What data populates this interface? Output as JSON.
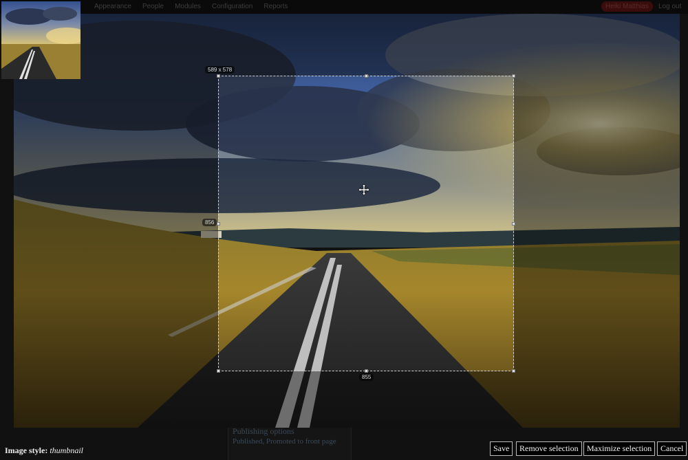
{
  "toolbar": {
    "nav": [
      "Appearance",
      "People",
      "Modules",
      "Configuration",
      "Reports"
    ],
    "user": "Heiki Matthias",
    "logout": "Log out"
  },
  "background_page": {
    "heading": "Publishing options",
    "text": "Published, Promoted to front page"
  },
  "cropper": {
    "size_label": "589 x 578",
    "height_value": "856",
    "width_value": "855"
  },
  "footer": {
    "style_prefix": "Image style:",
    "style_name": "thumbnail"
  },
  "actions": {
    "save": "Save",
    "remove": "Remove selection",
    "maximize": "Maximize selection",
    "cancel": "Cancel"
  }
}
